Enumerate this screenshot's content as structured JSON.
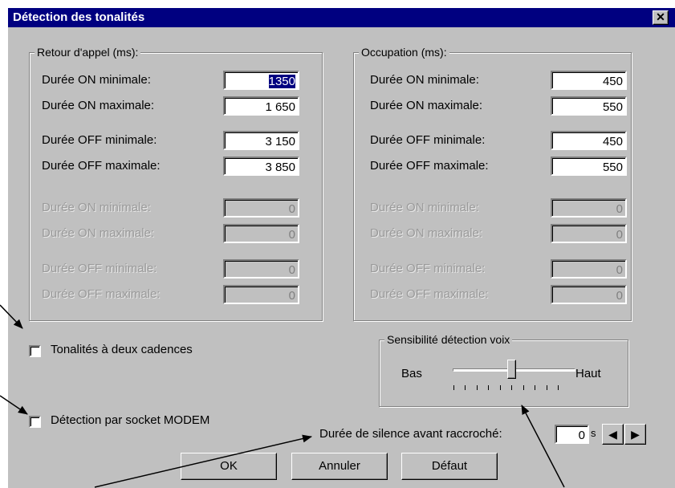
{
  "dialog": {
    "title": "Détection des tonalités",
    "close_glyph": "✕"
  },
  "ringback": {
    "legend": "Retour d'appel (ms):",
    "rows": [
      {
        "label": "Durée ON minimale:",
        "value": "1350",
        "enabled": true
      },
      {
        "label": "Durée ON maximale:",
        "value": "1 650",
        "enabled": true
      },
      {
        "label": "Durée OFF minimale:",
        "value": "3 150",
        "enabled": true
      },
      {
        "label": "Durée OFF maximale:",
        "value": "3 850",
        "enabled": true
      },
      {
        "label": "Durée ON minimale:",
        "value": "0",
        "enabled": false
      },
      {
        "label": "Durée ON maximale:",
        "value": "0",
        "enabled": false
      },
      {
        "label": "Durée OFF minimale:",
        "value": "0",
        "enabled": false
      },
      {
        "label": "Durée OFF maximale:",
        "value": "0",
        "enabled": false
      }
    ]
  },
  "busy": {
    "legend": "Occupation (ms):",
    "rows": [
      {
        "label": "Durée ON minimale:",
        "value": "450",
        "enabled": true
      },
      {
        "label": "Durée ON maximale:",
        "value": "550",
        "enabled": true
      },
      {
        "label": "Durée OFF minimale:",
        "value": "450",
        "enabled": true
      },
      {
        "label": "Durée OFF maximale:",
        "value": "550",
        "enabled": true
      },
      {
        "label": "Durée ON minimale:",
        "value": "0",
        "enabled": false
      },
      {
        "label": "Durée ON maximale:",
        "value": "0",
        "enabled": false
      },
      {
        "label": "Durée OFF minimale:",
        "value": "0",
        "enabled": false
      },
      {
        "label": "Durée OFF maximale:",
        "value": "0",
        "enabled": false
      }
    ]
  },
  "options": {
    "double_cadence_label": "Tonalités à deux cadences",
    "double_cadence_checked": false,
    "modem_label": "Détection par socket MODEM",
    "modem_checked": false
  },
  "sensitivity": {
    "legend": "Sensibilité détection voix",
    "low_label": "Bas",
    "high_label": "Haut",
    "tick_count": 10,
    "level": 0.55
  },
  "silence": {
    "label": "Durée de silence avant raccroché:",
    "value": "0",
    "unit": "s",
    "left_arrow": "◀",
    "right_arrow": "▶"
  },
  "buttons": {
    "ok": "OK",
    "cancel": "Annuler",
    "default": "Défaut"
  },
  "colors": {
    "titlebar": "#000080",
    "face": "#c0c0c0",
    "annotation": "#000000"
  }
}
